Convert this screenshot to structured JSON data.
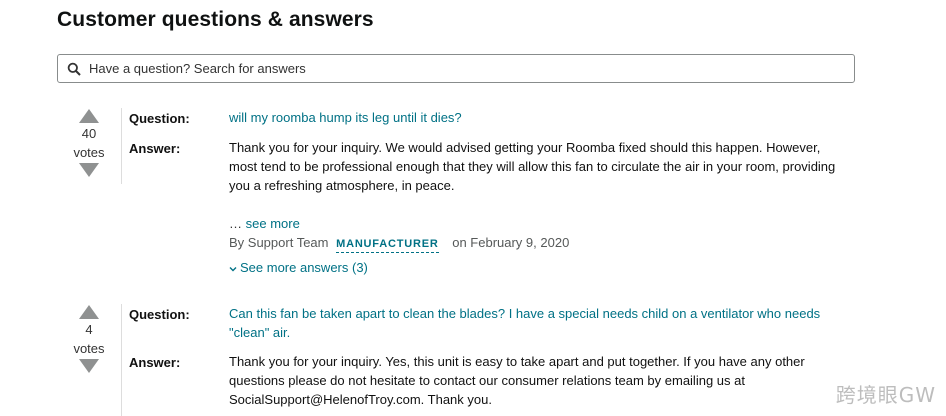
{
  "page_title": "Customer questions & answers",
  "search": {
    "placeholder": "Have a question? Search for answers"
  },
  "labels": {
    "question": "Question:",
    "answer": "Answer:",
    "votes": "votes"
  },
  "qa": [
    {
      "votes": "40",
      "question": "will my roomba hump its leg until it dies?",
      "answer": "Thank you for your inquiry. We would advised getting your Roomba fixed should this happen. However, most tend to be professional enough that they will allow this fan to circulate the air in your room, providing you a refreshing atmosphere, in peace.",
      "see_more_prefix": "… ",
      "see_more": "see more",
      "by_prefix": "By Support Team",
      "badge": "MANUFACTURER",
      "date": "on February 9, 2020",
      "more_answers": "See more answers (3)"
    },
    {
      "votes": "4",
      "question": "Can this fan be taken apart to clean the blades? I have a special needs child on a ventilator who needs \"clean\" air.",
      "answer": "Thank you for your inquiry. Yes, this unit is easy to take apart and put together. If you have any other questions please do not hesitate to contact our consumer relations team by emailing us at SocialSupport@HelenofTroy.com. Thank you."
    }
  ],
  "watermark": "跨境眼GW",
  "colors": {
    "link": "#007185",
    "arrow": "#8f9191",
    "border": "#888c8c"
  }
}
